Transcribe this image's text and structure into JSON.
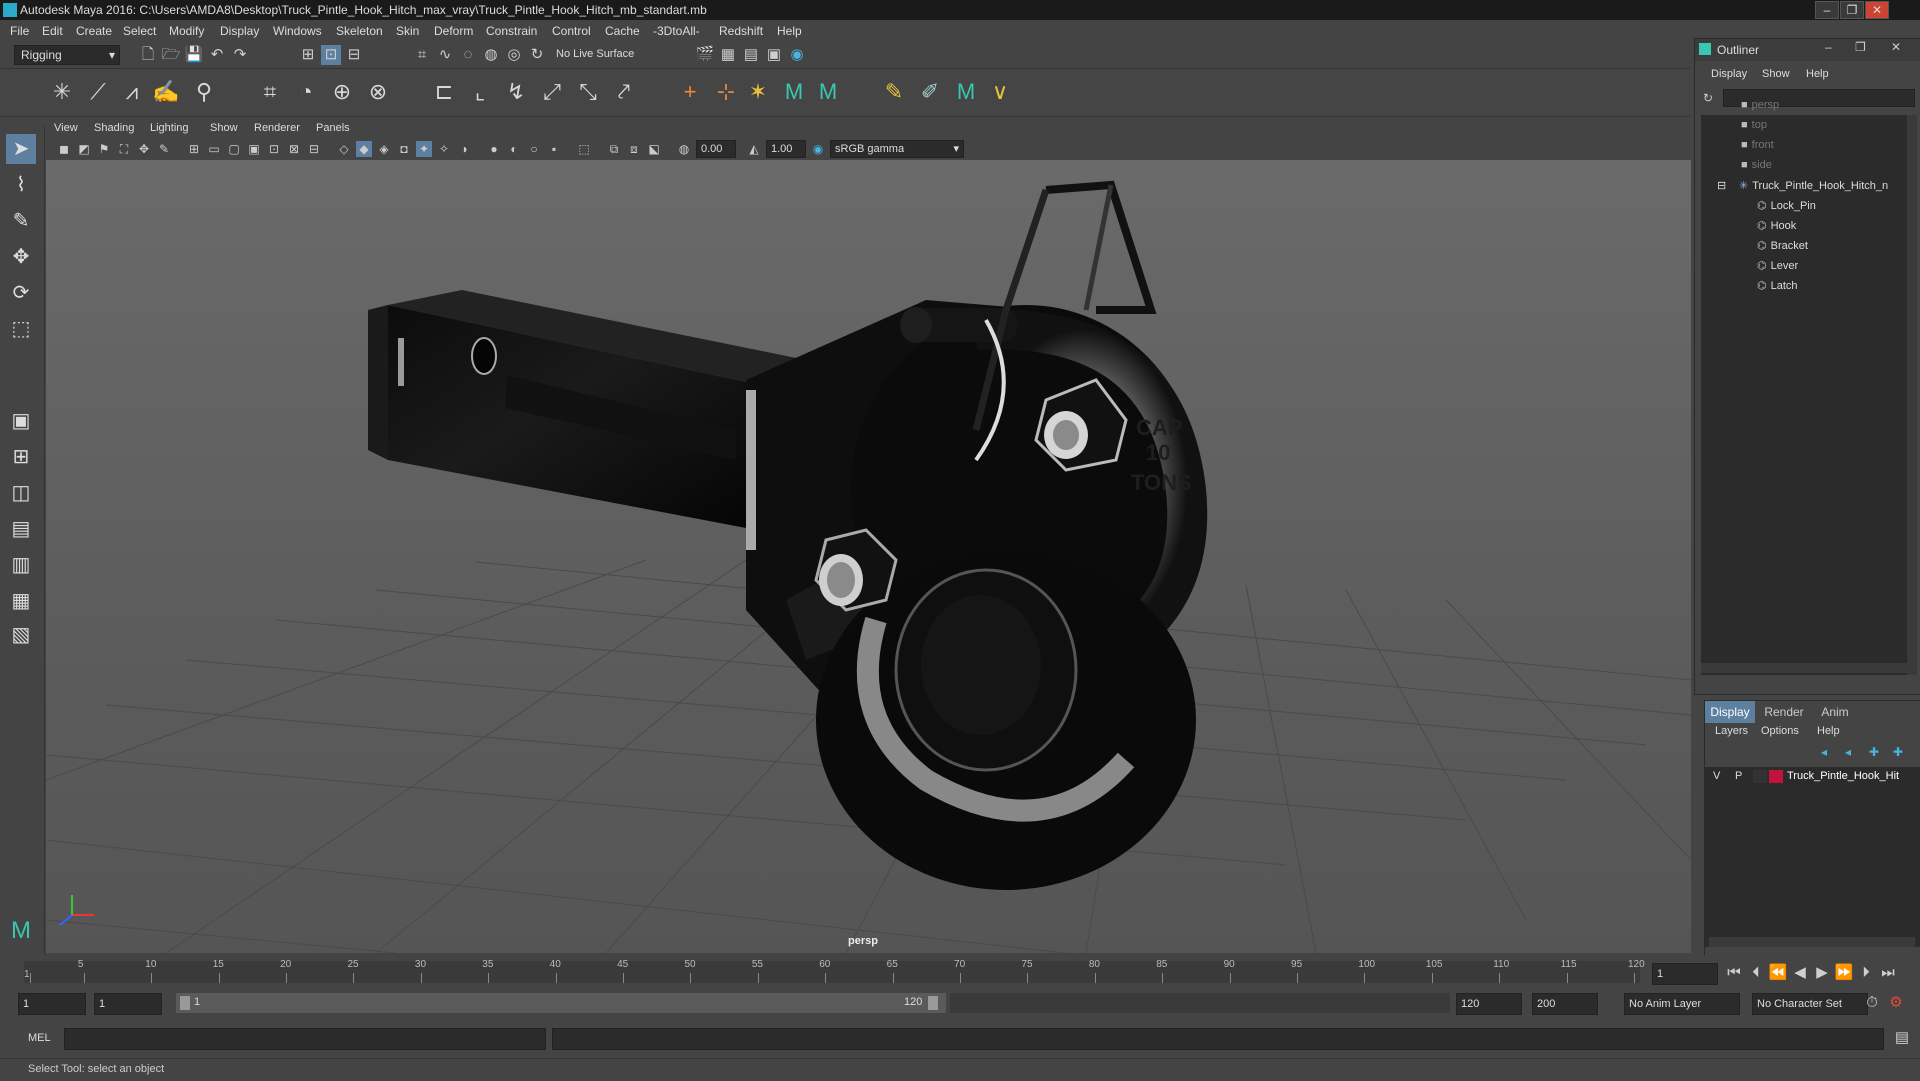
{
  "window": {
    "title": "Autodesk Maya 2016: C:\\Users\\AMDA8\\Desktop\\Truck_Pintle_Hook_Hitch_max_vray\\Truck_Pintle_Hook_Hitch_mb_standart.mb",
    "minimize": "–",
    "restore": "❐",
    "close": "✕"
  },
  "menubar": [
    "File",
    "Edit",
    "Create",
    "Select",
    "Modify",
    "Display",
    "Windows",
    "Skeleton",
    "Skin",
    "Deform",
    "Constrain",
    "Control",
    "Cache",
    "-3DtoAll-",
    "Redshift",
    "Help"
  ],
  "statusline": {
    "mode": "Rigging",
    "live_surface": "No Live Surface"
  },
  "panel_menu": [
    "View",
    "Shading",
    "Lighting",
    "Show",
    "Renderer",
    "Panels"
  ],
  "view_toolbar": {
    "value1": "0.00",
    "value2": "1.00",
    "color_space": "sRGB gamma"
  },
  "viewport": {
    "camera_label": "persp",
    "axis": {
      "x": "X",
      "y": "Y",
      "z": "Z"
    }
  },
  "model_text": {
    "cap": "CAP",
    "ten": "10",
    "tons": "TONS"
  },
  "outliner": {
    "title": "Outliner",
    "menu": [
      "Display",
      "Show",
      "Help"
    ],
    "items": [
      {
        "label": "persp",
        "type": "camera",
        "dim": true
      },
      {
        "label": "top",
        "type": "camera",
        "dim": true
      },
      {
        "label": "front",
        "type": "camera",
        "dim": true
      },
      {
        "label": "side",
        "type": "camera",
        "dim": true
      },
      {
        "label": "Truck_Pintle_Hook_Hitch_n",
        "type": "group",
        "dim": false
      },
      {
        "label": "Lock_Pin",
        "type": "mesh",
        "dim": false
      },
      {
        "label": "Hook",
        "type": "mesh",
        "dim": false
      },
      {
        "label": "Bracket",
        "type": "mesh",
        "dim": false
      },
      {
        "label": "Lever",
        "type": "mesh",
        "dim": false
      },
      {
        "label": "Latch",
        "type": "mesh",
        "dim": false
      }
    ]
  },
  "layer_editor": {
    "tabs": [
      "Display",
      "Render",
      "Anim"
    ],
    "menu": [
      "Layers",
      "Options",
      "Help"
    ],
    "layer": {
      "v": "V",
      "p": "P",
      "name": "Truck_Pintle_Hook_Hit",
      "color": "#c0143c"
    }
  },
  "timeline": {
    "ticks": [
      "1",
      "5",
      "10",
      "15",
      "20",
      "25",
      "30",
      "35",
      "40",
      "45",
      "50",
      "55",
      "60",
      "65",
      "70",
      "75",
      "80",
      "85",
      "90",
      "95",
      "100",
      "105",
      "110",
      "115",
      "120"
    ],
    "current_frame": "1"
  },
  "range": {
    "start": "1",
    "playback_start": "1",
    "slider_start": "1",
    "slider_end": "120",
    "playback_end": "120",
    "end": "200",
    "anim_layer": "No Anim Layer",
    "character_set": "No Character Set"
  },
  "cmdline": {
    "label": "MEL"
  },
  "helpline": {
    "text": "Select Tool: select an object"
  }
}
